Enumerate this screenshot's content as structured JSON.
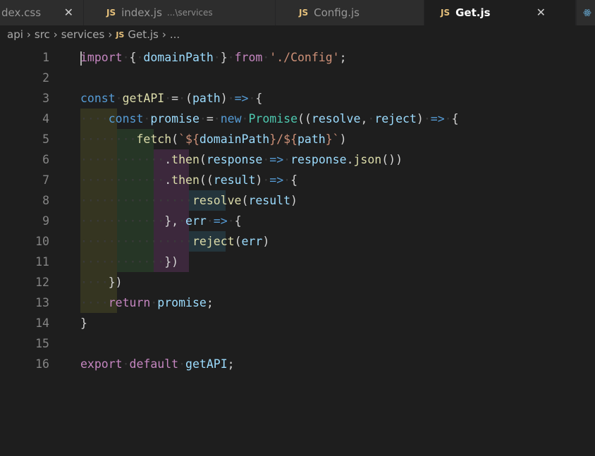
{
  "tabs": [
    {
      "label": "dex.css",
      "description": "",
      "active": false,
      "icon": "none"
    },
    {
      "label": "index.js",
      "description": "...\\services",
      "active": false,
      "icon": "js-icon"
    },
    {
      "label": "Config.js",
      "description": "",
      "active": false,
      "icon": "js-icon"
    },
    {
      "label": "Get.js",
      "description": "",
      "active": true,
      "icon": "js-icon"
    }
  ],
  "tab_close": "✕",
  "tab_js": "JS",
  "breadcrumb": {
    "parts": [
      "api",
      "src",
      "services",
      "Get.js",
      "..."
    ],
    "separator": "›"
  },
  "editor": {
    "line_numbers": [
      "1",
      "2",
      "3",
      "4",
      "5",
      "6",
      "7",
      "8",
      "9",
      "10",
      "11",
      "12",
      "13",
      "14",
      "15",
      "16"
    ],
    "tokens": {
      "import": "import",
      "domainPath": "domainPath",
      "from": "from",
      "config_path": "'./Config'",
      "const": "const",
      "getAPI": "getAPI",
      "path": "path",
      "arrow": "=>",
      "promise": "promise",
      "new": "new",
      "Promise": "Promise",
      "resolve": "resolve",
      "reject": "reject",
      "fetch": "fetch",
      "then": "then",
      "response": "response",
      "json": "json",
      "result": "result",
      "err": "err",
      "return": "return",
      "export": "export",
      "default": "default"
    }
  }
}
